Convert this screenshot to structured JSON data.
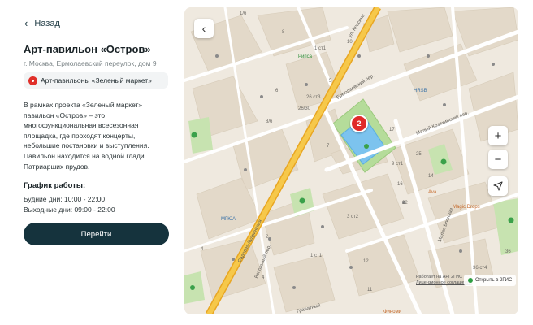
{
  "nav": {
    "back_label": "Назад"
  },
  "place": {
    "title": "Арт-павильон «Остров»",
    "address": "г. Москва, Ермолаевский переулок, дом 9",
    "category": "Арт-павильоны «Зеленый маркет»",
    "description": "В рамках проекта «Зеленый маркет» павильон «Остров» – это многофункциональная всесезонная площадка, где проходят концерты, небольшие постановки и выступления. Павильон находится на водной глади Патриарших прудов."
  },
  "schedule": {
    "title": "График работы:",
    "weekdays": "Будние дни: 10:00 - 22:00",
    "weekends": "Выходные дни: 09:00 - 22:00"
  },
  "actions": {
    "go_label": "Перейти"
  },
  "map": {
    "zoom_in": "+",
    "zoom_out": "−",
    "cluster_count": "2",
    "streets": {
      "krasina": "ул. Красина",
      "ermolaevsky": "Ермолаевский пер.",
      "maly_kozikhinsky": "Малый Козихинский пер.",
      "sadovaya_kudrinskaya": "Садовая-Кудринская",
      "vspolny": "Вспольный пер.",
      "malaya_bronnaya": "Малая Бронная",
      "granatny": "Гранатный"
    },
    "pois": {
      "ripsa": "Рипса",
      "hrsb": "HRSB",
      "mgyua": "МГЮА",
      "ava": "Ava",
      "magic_drops": "Magic Drops",
      "finomi": "Финоми"
    },
    "house_numbers": [
      "1/6",
      "8",
      "10",
      "1 ст1",
      "5",
      "6",
      "26 ст3",
      "26/30",
      "8/6",
      "7",
      "9 ст1",
      "14",
      "17",
      "22",
      "25",
      "4",
      "2",
      "3 ст2",
      "1 ст1",
      "36",
      "36 ст4",
      "12",
      "16",
      "4",
      "11"
    ],
    "attribution_line1": "Работает на API 2ГИС",
    "attribution_line2": "Лицензионное соглашение",
    "open_in_2gis": "Открыть в 2ГИС"
  }
}
